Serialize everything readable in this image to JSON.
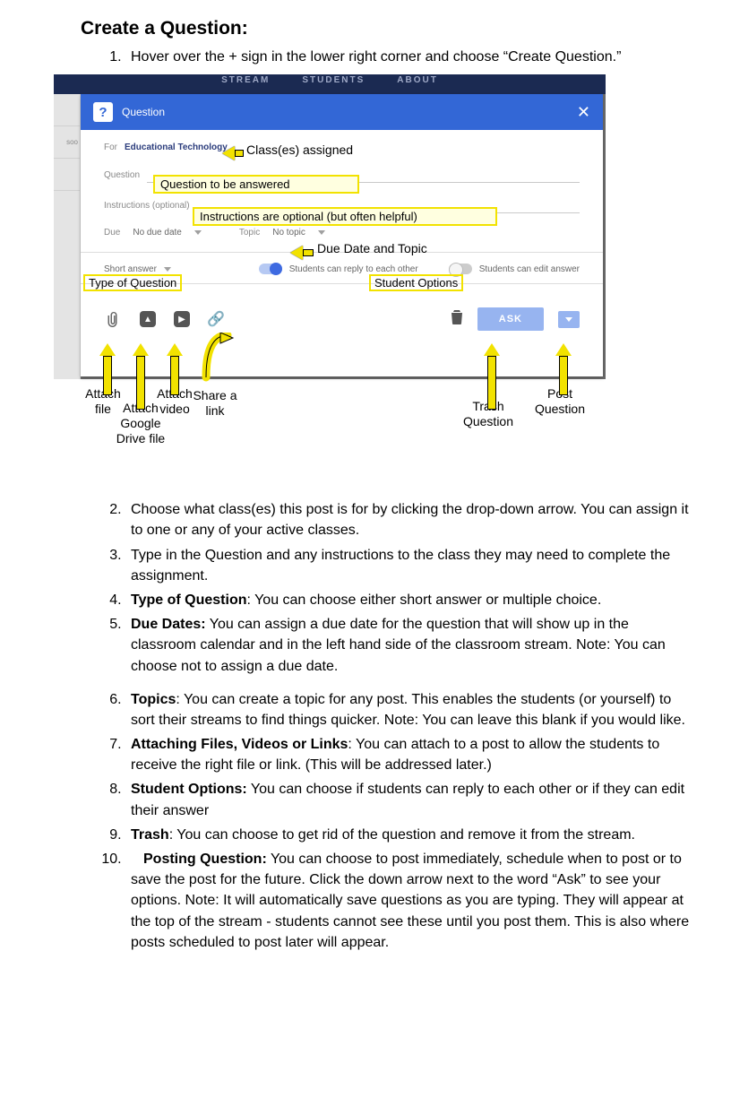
{
  "title": "Create a Question:",
  "steps": [
    "Hover over the + sign in the lower right corner and choose “Create Question.”",
    "Choose what class(es) this post is for by clicking the drop-down arrow. You can assign it to one or any of your active classes.",
    "Type in the Question and any instructions to the class they may need to complete the assignment.",
    {
      "bold": "Type of Question",
      "rest": ": You can choose either short answer or multiple choice."
    },
    {
      "bold": "Due Dates:",
      "rest": " You can assign a due date for the question that will show up in the classroom calendar and in the left hand side of the classroom stream. Note: You can choose not to assign a due date."
    },
    {
      "bold": "Topics",
      "rest": ": You can create a topic for any post. This enables the students (or yourself) to sort their streams to find things quicker. Note: You can leave this blank if you would like."
    },
    {
      "bold": "Attaching Files, Videos or Links",
      "rest": ": You can attach to a post to allow the students to receive the right file or link. (This will be addressed later.)"
    },
    {
      "bold": "Student Options:",
      "rest": " You can choose if students can reply to each other or if they can edit their answer"
    },
    {
      "bold": "Trash",
      "rest": ": You can choose to get rid of the question and remove it from the stream."
    },
    {
      "bold": "Posting Question:",
      "rest": " You can choose to post immediately, schedule when to post or to save the post for the future. Click the down arrow next to the word “Ask” to see your options. Note: It will automatically save questions as you are typing. They will appear at the top of the stream - students cannot see these until you post them. This is also where posts scheduled to post later will appear."
    }
  ],
  "nav": {
    "stream": "STREAM",
    "students": "STUDENTS",
    "about": "ABOUT"
  },
  "card": {
    "header_label": "Question",
    "for_label": "For",
    "class_name": "Educational Technology",
    "question_label": "Question",
    "instructions_label": "Instructions (optional)",
    "due_label": "Due",
    "due_value": "No due date",
    "topic_label": "Topic",
    "topic_value": "No topic",
    "qtype": "Short answer",
    "reply_label": "Students can reply to each other",
    "edit_label": "Students can edit answer",
    "ask_label": "ASK"
  },
  "annotations": {
    "classes_assigned": "Class(es) assigned",
    "question_box": "Question to be answered",
    "instructions_box": "Instructions are optional (but often helpful)",
    "due_topic": "Due Date and Topic",
    "type_of_question": "Type of Question",
    "student_options": "Student Options",
    "attach_file": "Attach file",
    "attach_drive": "Attach Google Drive file",
    "attach_video": "Attach video",
    "share_link": "Share a link",
    "trash_q": "Trash Question",
    "post_q": "Post Question"
  },
  "sidebar_bit": "soo"
}
